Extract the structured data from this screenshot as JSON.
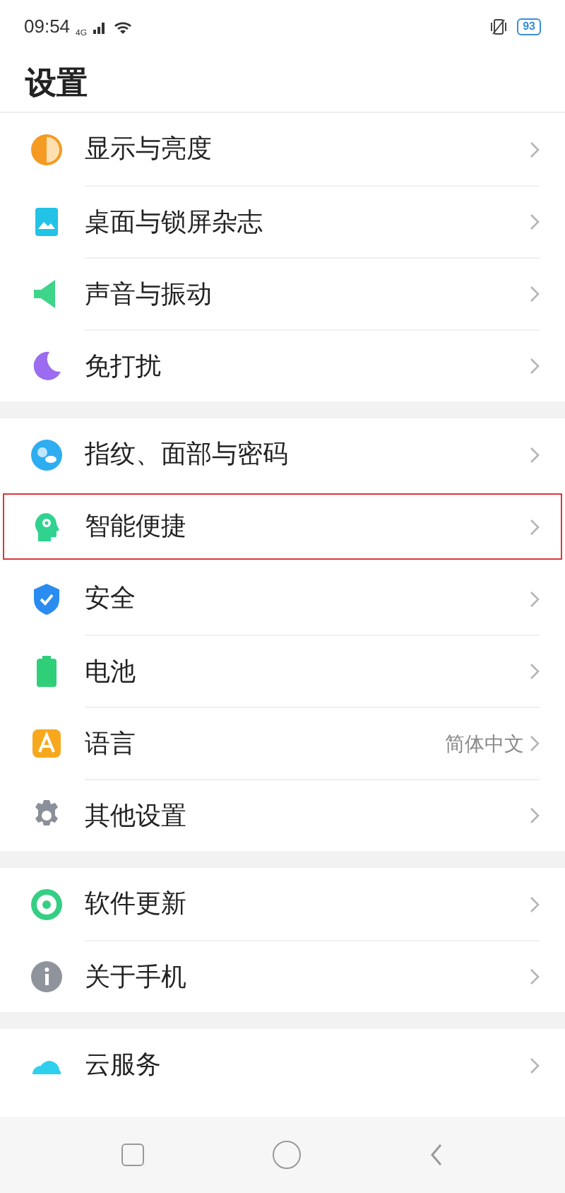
{
  "status_bar": {
    "time": "09:54",
    "network": "4G",
    "battery": "93"
  },
  "title": "设置",
  "groups": [
    {
      "items": [
        {
          "kind": "brightness",
          "label": "显示与亮度",
          "highlighted": false
        },
        {
          "kind": "wallpaper",
          "label": "桌面与锁屏杂志",
          "highlighted": false
        },
        {
          "kind": "sound",
          "label": "声音与振动",
          "highlighted": false
        },
        {
          "kind": "moon",
          "label": "免打扰",
          "highlighted": false
        }
      ]
    },
    {
      "items": [
        {
          "kind": "fingerprint",
          "label": "指纹、面部与密码",
          "highlighted": false
        },
        {
          "kind": "smart",
          "label": "智能便捷",
          "highlighted": true
        },
        {
          "kind": "shield",
          "label": "安全",
          "highlighted": false
        },
        {
          "kind": "battery",
          "label": "电池",
          "highlighted": false
        },
        {
          "kind": "language",
          "label": "语言",
          "value": "简体中文",
          "highlighted": false
        },
        {
          "kind": "gear",
          "label": "其他设置",
          "highlighted": false
        }
      ]
    },
    {
      "items": [
        {
          "kind": "update",
          "label": "软件更新",
          "highlighted": false
        },
        {
          "kind": "info",
          "label": "关于手机",
          "highlighted": false
        }
      ]
    },
    {
      "items": [
        {
          "kind": "cloud",
          "label": "云服务",
          "highlighted": false
        }
      ]
    }
  ]
}
